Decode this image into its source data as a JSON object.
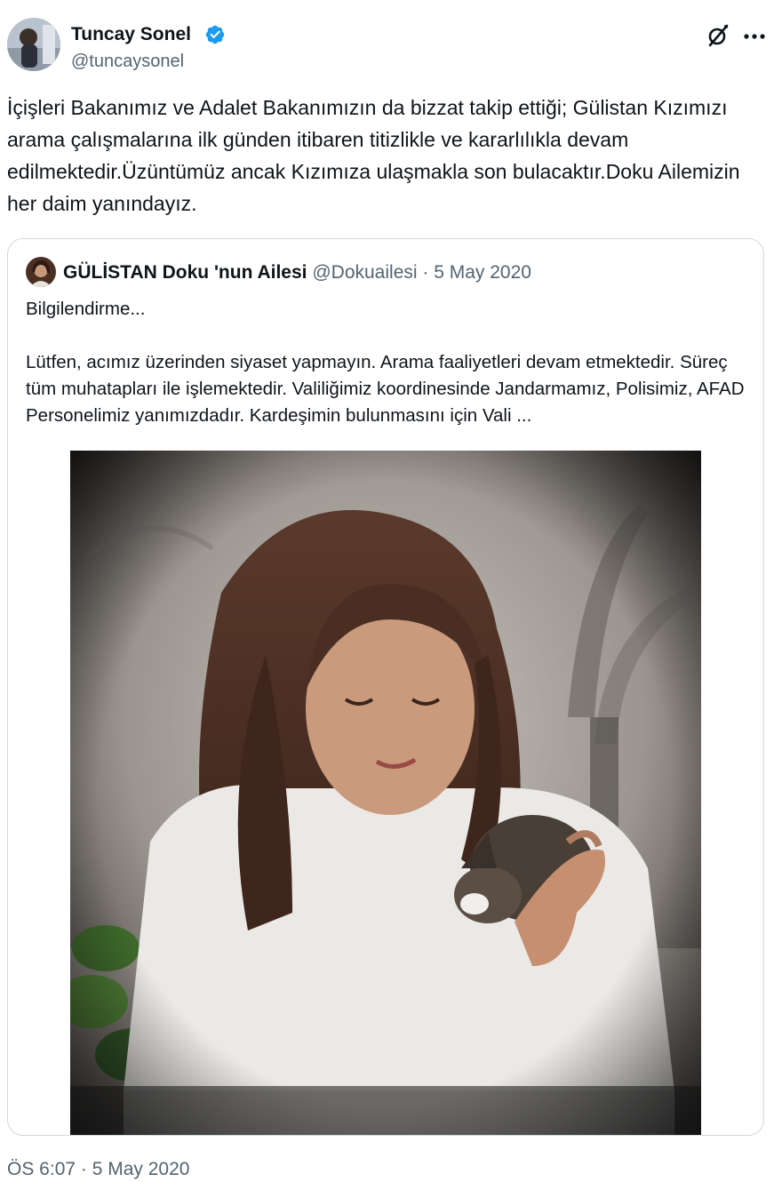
{
  "author": {
    "name": "Tuncay Sonel",
    "handle": "@tuncaysonel",
    "verified": true,
    "verified_color": "#1d9bf0"
  },
  "header_icons": [
    "grok-icon",
    "more-icon"
  ],
  "tweet": {
    "text": "İçişleri Bakanımız ve Adalet Bakanımızın da bizzat takip ettiği; Gülistan Kızımızı arama çalışmalarına ilk günden itibaren titizlikle ve kararlılıkla devam edilmektedir.Üzüntümüz ancak Kızımıza ulaşmakla son bulacaktır.Doku Ailemizin her daim yanındayız.",
    "timestamp": "ÖS 6:07 · 5 May 2020"
  },
  "quote": {
    "author_name": "GÜLİSTAN Doku 'nun Ailesi",
    "handle": "@Dokuailesi",
    "separator": " · ",
    "date": "5 May 2020",
    "text_line1": "Bilgilendirme...",
    "text_line2": "Lütfen, acımız üzerinden siyaset yapmayın. Arama faaliyetleri devam etmektedir. Süreç tüm muhatapları ile işlemektedir. Valiliğimiz koordinesinde Jandarmamız, Polisimiz, AFAD Personelimiz yanımızdadır. Kardeşimin bulunmasını için Vali ..."
  },
  "colors": {
    "text_primary": "#0f1419",
    "text_secondary": "#536471",
    "border": "#cfd9de"
  }
}
